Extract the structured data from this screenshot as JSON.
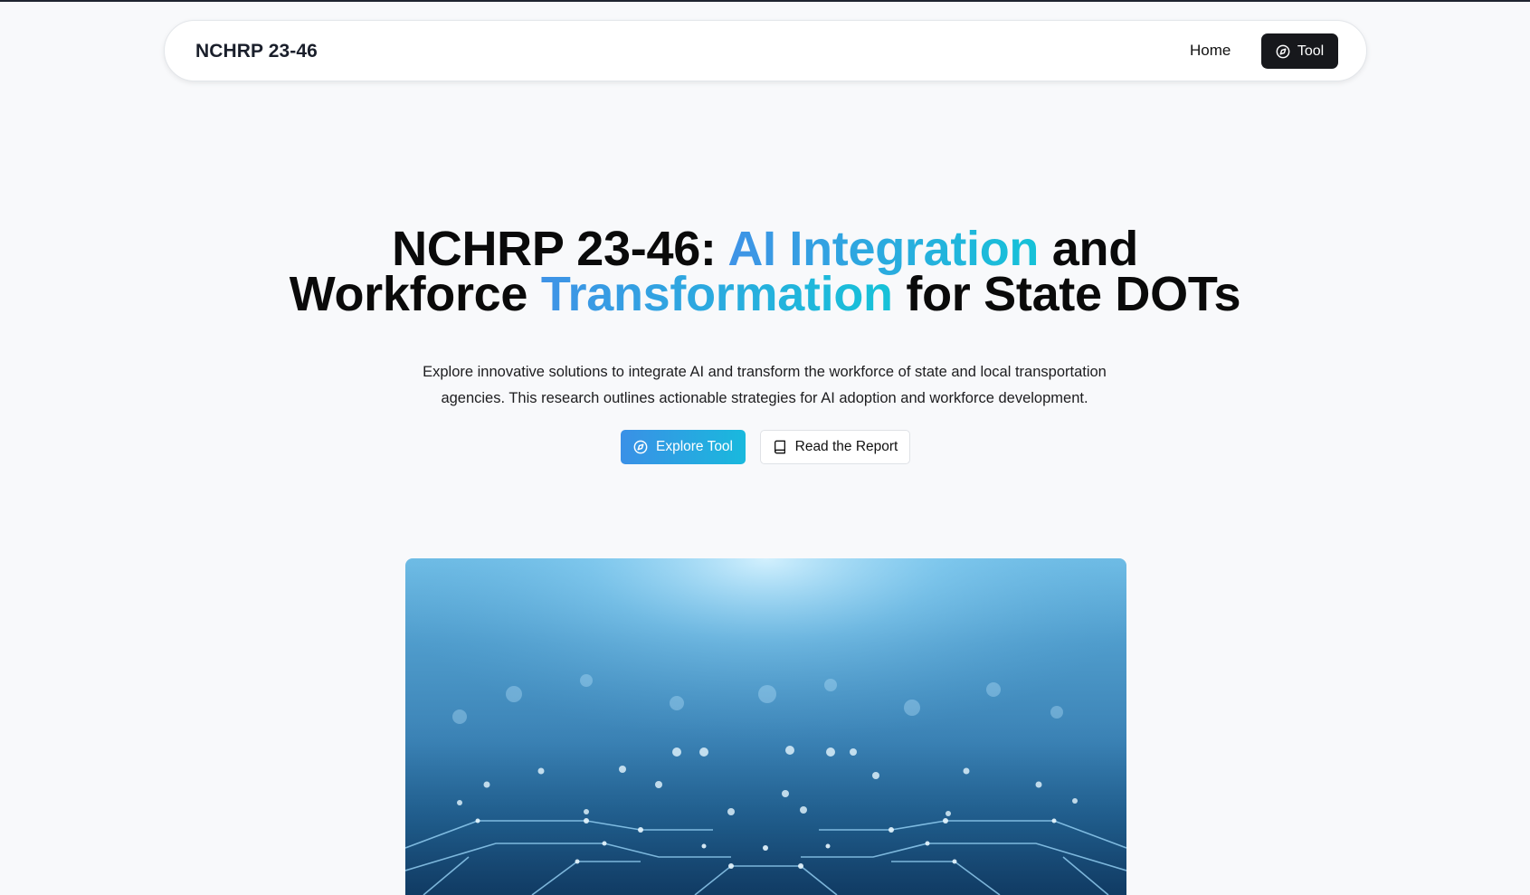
{
  "navbar": {
    "brand": "NCHRP 23-46",
    "home_label": "Home",
    "tool_label": "Tool",
    "tool_icon": "compass-icon"
  },
  "hero": {
    "title_line1_prefix": "NCHRP 23-46: ",
    "title_line1_highlight": "AI Integration",
    "title_line1_suffix": " and",
    "title_line2_prefix": "Workforce ",
    "title_line2_highlight": "Transformation",
    "title_line2_suffix": " for State DOTs",
    "description": "Explore innovative solutions to integrate AI and transform the workforce of state and local transportation agencies. This research outlines actionable strategies for AI adoption and workforce development.",
    "primary_button": "Explore Tool",
    "primary_icon": "compass-icon",
    "secondary_button": "Read the Report",
    "secondary_icon": "book-icon",
    "image_alt": "circuit-board-image"
  },
  "colors": {
    "gradient_start": "#3f93e6",
    "gradient_end": "#16c2d8",
    "dark_button": "#17181c",
    "page_bg": "#f8f9fb"
  }
}
